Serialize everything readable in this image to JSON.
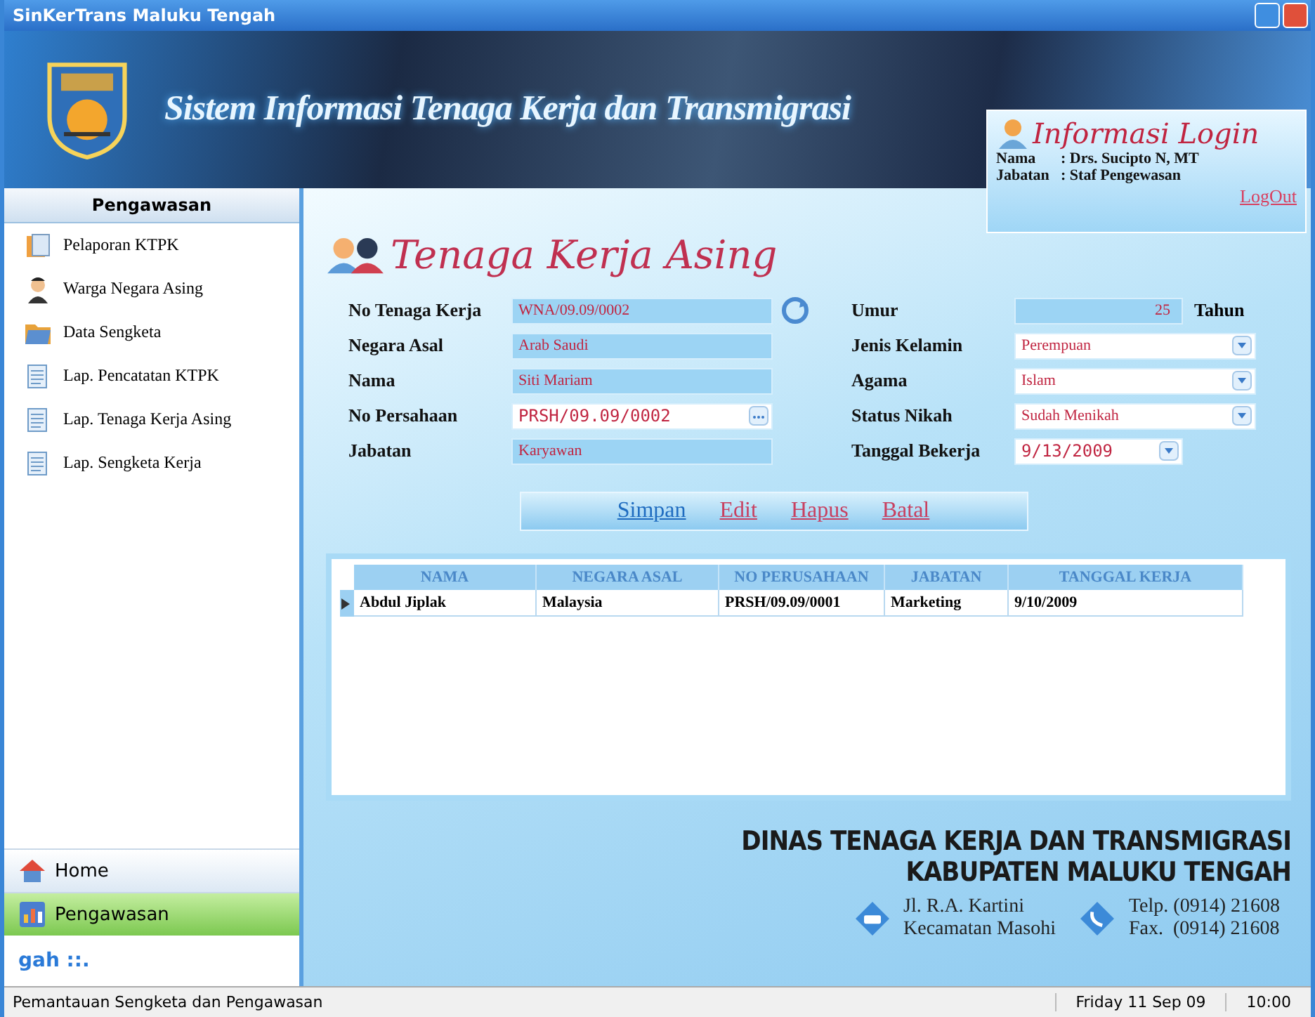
{
  "window": {
    "title": "SinKerTrans Maluku Tengah"
  },
  "banner": {
    "title": "Sistem Informasi Tenaga Kerja dan Transmigrasi"
  },
  "login": {
    "title": "Informasi Login",
    "fields": [
      {
        "label": "Nama",
        "value": ": Drs. Sucipto N, MT"
      },
      {
        "label": "Jabatan",
        "value": ": Staf Pengewasan"
      }
    ],
    "logout": "LogOut"
  },
  "sidebar": {
    "header": "Pengawasan",
    "items": [
      {
        "label": "Pelaporan KTPK",
        "kind": "report"
      },
      {
        "label": "Warga Negara Asing",
        "kind": "person"
      },
      {
        "label": "Data Sengketa",
        "kind": "folder"
      },
      {
        "label": "Lap. Pencatatan KTPK",
        "kind": "document"
      },
      {
        "label": "Lap. Tenaga Kerja Asing",
        "kind": "document"
      },
      {
        "label": "Lap. Sengketa Kerja",
        "kind": "document"
      }
    ],
    "nav": [
      {
        "label": "Home",
        "kind": "home",
        "selected": false
      },
      {
        "label": "Pengawasan",
        "kind": "chart",
        "selected": true
      }
    ],
    "footer_text": "gah ::."
  },
  "form": {
    "title": "Tenaga Kerja Asing",
    "left_fields": [
      {
        "label": "No Tenaga Kerja",
        "value": "WNA/09.09/0002",
        "kind": "refresh"
      },
      {
        "label": "Negara Asal",
        "value": "Arab Saudi",
        "kind": "readonly"
      },
      {
        "label": "Nama",
        "value": "Siti Mariam",
        "kind": "readonly"
      },
      {
        "label": "No Persahaan",
        "value": "PRSH/09.09/0002",
        "kind": "browse"
      },
      {
        "label": "Jabatan",
        "value": "Karyawan",
        "kind": "readonly"
      }
    ],
    "right_fields": [
      {
        "label": "Umur",
        "value": "25",
        "kind": "number",
        "unit": "Tahun"
      },
      {
        "label": "Jenis Kelamin",
        "value": "Perempuan",
        "kind": "combo"
      },
      {
        "label": "Agama",
        "value": "Islam",
        "kind": "combo"
      },
      {
        "label": "Status Nikah",
        "value": "Sudah Menikah",
        "kind": "combo"
      },
      {
        "label": "Tanggal Bekerja",
        "value": "9/13/2009",
        "kind": "date"
      }
    ],
    "actions": [
      {
        "label": "Simpan",
        "hovered": true
      },
      {
        "label": "Edit",
        "hovered": false
      },
      {
        "label": "Hapus",
        "hovered": false
      },
      {
        "label": "Batal",
        "hovered": false
      }
    ]
  },
  "table": {
    "columns": [
      "NAMA",
      "NEGARA ASAL",
      "NO PERUSAHAAN",
      "JABATAN",
      "TANGGAL KERJA"
    ],
    "rows": [
      {
        "current": true,
        "cells": [
          "Abdul Jiplak",
          "Malaysia",
          "PRSH/09.09/0001",
          "Marketing",
          "9/10/2009"
        ]
      }
    ]
  },
  "footer": {
    "agency": [
      "DINAS TENAGA KERJA DAN TRANSMIGRASI",
      "KABUPATEN MALUKU TENGAH"
    ],
    "address": [
      "Jl. R.A. Kartini",
      "Kecamatan Masohi"
    ],
    "phone": [
      "Telp. (0914) 21608",
      "Fax.  (0914) 21608"
    ]
  },
  "status_bar": {
    "message": "Pemantauan Sengketa dan Pengawasan",
    "date": "Friday 11 Sep 09",
    "time": "10:00"
  }
}
